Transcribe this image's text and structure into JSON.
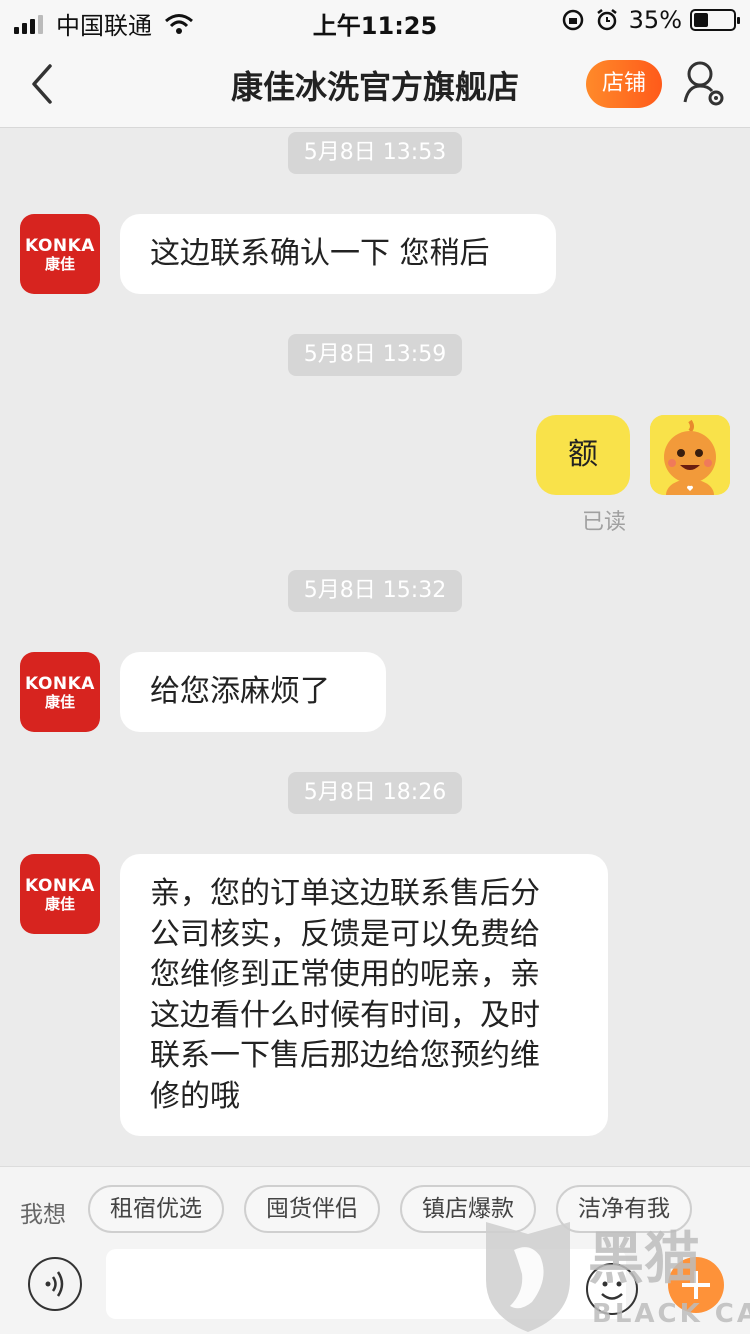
{
  "status_bar": {
    "carrier": "中国联通",
    "time": "上午11:25",
    "battery": "35%"
  },
  "nav": {
    "title": "康佳冰洗官方旗舰店",
    "shop_button": "店铺"
  },
  "messages": [
    {
      "time": "5月8日 13:53",
      "from": "shop",
      "text": "这边联系确认一下  您稍后"
    },
    {
      "time": "5月8日 13:59",
      "from": "me",
      "text": "额",
      "status": "已读"
    },
    {
      "time": "5月8日 15:32",
      "from": "shop",
      "text": "给您添麻烦了"
    },
    {
      "time": "5月8日 18:26",
      "from": "shop",
      "lines": [
        "亲，您的订单这边联系售后分",
        "公司核实，反馈是可以免费给",
        "您维修到正常使用的呢亲，亲",
        "这边看什么时候有时间，及时",
        "联系一下售后那边给您预约维",
        "修的哦"
      ]
    }
  ],
  "shop_avatar": {
    "en": "KONKA",
    "cn": "康佳"
  },
  "bottom": {
    "want_label": "我想",
    "chips": [
      "租宿优选",
      "囤货伴侣",
      "镇店爆款",
      "洁净有我"
    ]
  },
  "watermark": {
    "cn": "黑猫",
    "en": "BLACK CAT"
  },
  "colors": {
    "accent": "#ff6a1f",
    "avatar_red": "#d7241f",
    "my_bubble": "#f9e24a"
  }
}
